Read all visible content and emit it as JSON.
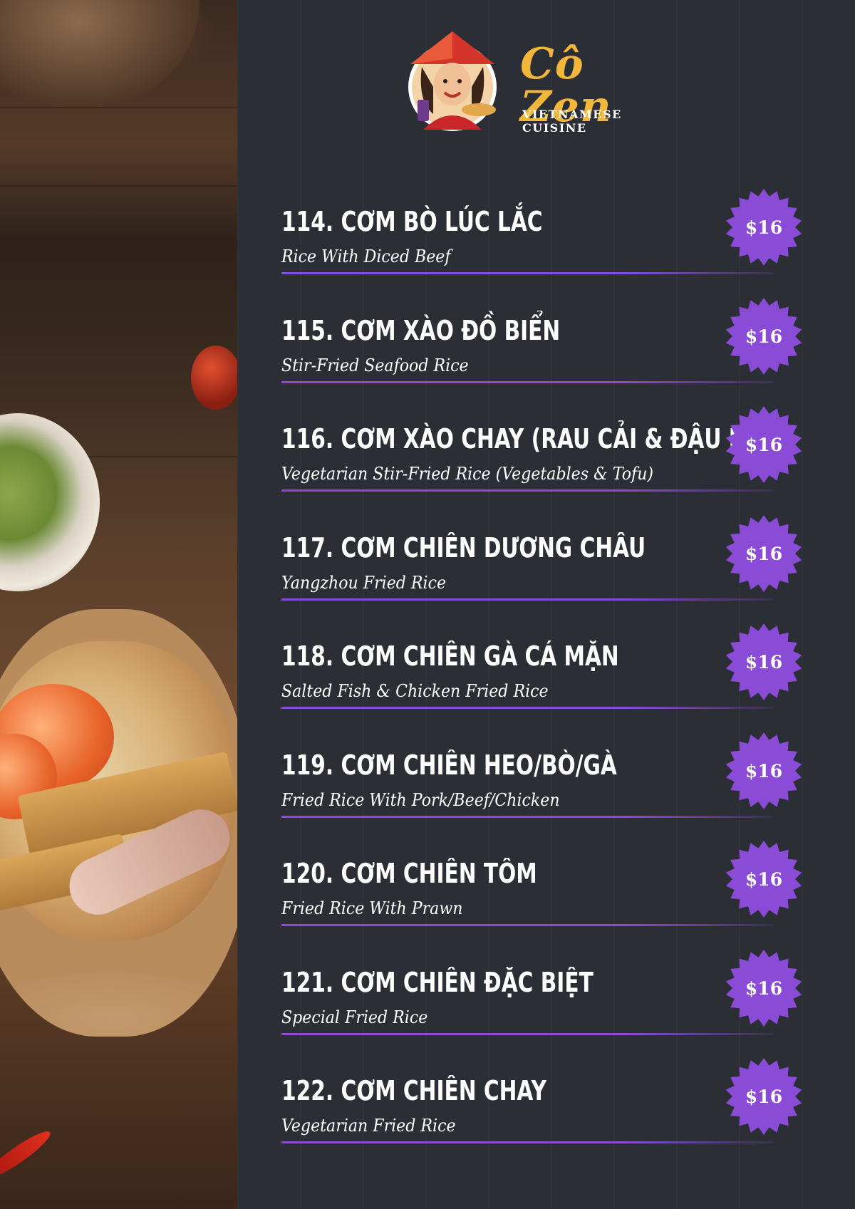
{
  "brand": {
    "name": "Cô Zen",
    "tagline": "VIETNAMESE CUISINE",
    "accent_color": "#f2b73a",
    "logo_icon": "chef-mascot-icon"
  },
  "colors": {
    "background": "#2b2e34",
    "price_badge": "#8a4bd6",
    "divider": "#8a4bd6",
    "text": "#ffffff"
  },
  "menu_items": [
    {
      "title": "114. CƠM BÒ LÚC LẮC",
      "subtitle": "Rice With Diced Beef",
      "price": "$16"
    },
    {
      "title": "115. CƠM XÀO ĐỒ BIỂN",
      "subtitle": "Stir-Fried Seafood Rice",
      "price": "$16"
    },
    {
      "title": "116. CƠM XÀO CHAY (RAU CẢI & ĐẬU HŨ)",
      "subtitle": "Vegetarian Stir-Fried Rice (Vegetables & Tofu)",
      "price": "$16"
    },
    {
      "title": "117. CƠM CHIÊN DƯƠNG CHÂU",
      "subtitle": "Yangzhou Fried Rice",
      "price": "$16"
    },
    {
      "title": "118. CƠM CHIÊN GÀ CÁ MẶN",
      "subtitle": "Salted Fish & Chicken Fried Rice",
      "price": "$16"
    },
    {
      "title": "119. CƠM CHIÊN HEO/BÒ/GÀ",
      "subtitle": "Fried Rice With Pork/Beef/Chicken",
      "price": "$16"
    },
    {
      "title": "120. CƠM CHIÊN TÔM",
      "subtitle": "Fried Rice With Prawn",
      "price": "$16"
    },
    {
      "title": "121. CƠM CHIÊN ĐẶC BIỆT",
      "subtitle": "Special Fried Rice",
      "price": "$16"
    },
    {
      "title": "122. CƠM CHIÊN CHAY",
      "subtitle": "Vegetarian Fried Rice",
      "price": "$16"
    }
  ]
}
